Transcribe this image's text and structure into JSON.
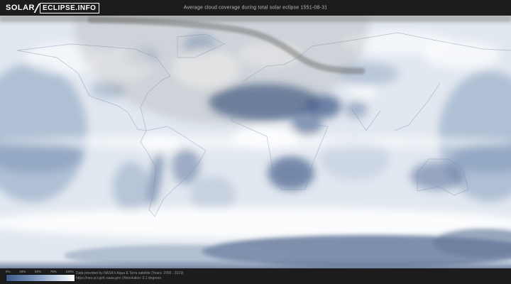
{
  "header": {
    "logo": {
      "primary": "SOLAR",
      "secondary": "ECLIPSE.INFO"
    },
    "title": "Average cloud coverage during total solar eclipse 1551-08-31"
  },
  "map": {
    "kind": "equirectangular world map of average cloud coverage",
    "overlays": [
      "penumbra shading over northern hemisphere",
      "dark band of path of totality curving from upper-left across Europe/Asia"
    ],
    "colors": {
      "low_cloud": "#3f588a",
      "high_cloud": "#ffffff",
      "ocean_mid": "#9fb2cb",
      "shadow_band": "#6b6b68"
    }
  },
  "legend": {
    "tick_labels": [
      "0%",
      "25%",
      "50%",
      "75%",
      "100%"
    ],
    "gradient_start_color": "#3f588a",
    "gradient_end_color": "#ffffff"
  },
  "footer": {
    "attribution_line1": "Data provided by NASA's Aqua & Terra satellite (Years: 2000 - 2019)",
    "attribution_line2": "https://neo.sci.gsfc.nasa.gov | Resolution: 0.1 degrees"
  }
}
